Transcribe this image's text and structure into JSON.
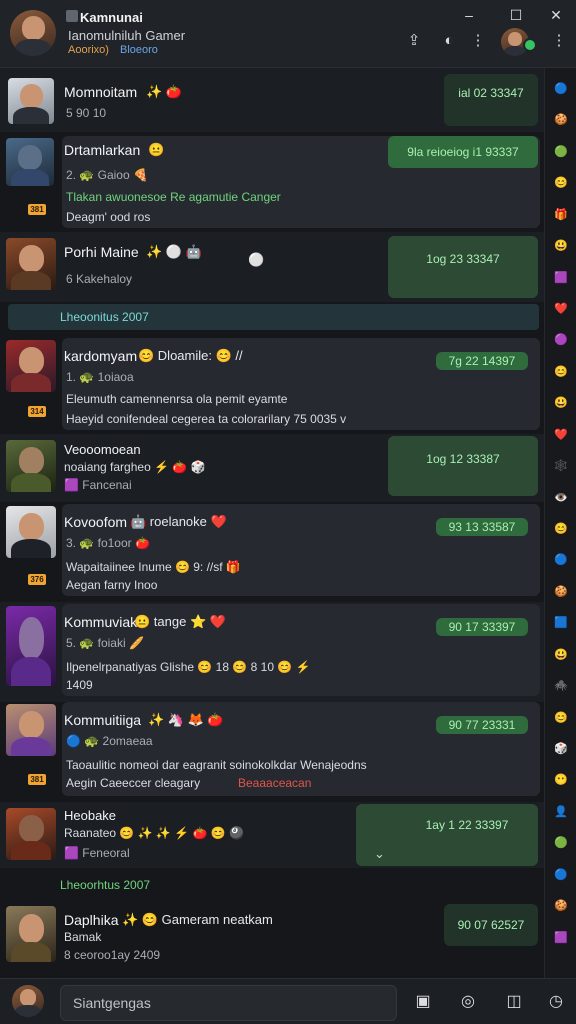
{
  "header": {
    "title": "Kamnunai",
    "subtitle": "Ianomulniluh Gamer",
    "tag1": "Aoorixo)",
    "tag2": "Bloeoro",
    "window": {
      "minimize": "–",
      "maximize": "☐",
      "close": "✕"
    },
    "icons": {
      "share": "⇪",
      "flag": "◐",
      "more": "⋮",
      "menu": "⋮"
    }
  },
  "chats": [
    {
      "name": "Momnoitam",
      "emoji": "✨ 🍅",
      "meta": "5  90 10",
      "time": "ial 02 33347"
    },
    {
      "name": "Drtamlarkan",
      "emoji": "😐",
      "meta": "2.  🐢 Gaioo  🍕",
      "msg1": "Tlakan awuonesoe Re agamutie Canger",
      "msg2": "Deagm' ood ros",
      "time": "9la reioeiog i1 93337",
      "badge": "381"
    },
    {
      "name": "Porhi Maine",
      "emoji": "✨ ⚪ 🤖",
      "meta": "6  Kakehaloy",
      "time": "1og 23 33347"
    },
    {
      "name": "kardomyam",
      "emoji": "😊 Dloamile: 😊 //",
      "meta": "1.  🐢 1oiaoa",
      "msg1": "Eleumuth camennenrsa ola pemit eyamte",
      "msg2": "Haeyid conifendeal cegerea  ta colorarilary 75 0035 v",
      "time": "7g 22 14397",
      "badge": "314"
    },
    {
      "name": "Veooomoean",
      "emoji": "",
      "meta2": "noaiang fargheo  ⚡ 🍅 🎲",
      "meta": "🟪 Fancenai",
      "time": "1og 12 33387"
    },
    {
      "name": "Kovoofom",
      "emoji": "🤖 roelanoke  ❤️",
      "meta": "3.  🐢 fo1oor  🍅",
      "msg1": "Wapaitaiinee Inume  😊 9:  //sf 🎁",
      "msg2": "Aegan farny Inoo",
      "time": "93 13 33587",
      "badge": "376"
    },
    {
      "name": "Kommuviaki",
      "emoji": "😐 tange  ⭐ ❤️",
      "meta": "5.  🐢 foiaki  🥖",
      "msg1": "Ilpenelrpanatiyas Glishe  😊 18   😊 8 10  😊 ⚡",
      "msg2": "1409",
      "time": "90 17 33397"
    },
    {
      "name": "Kommuitiiga",
      "emoji": "✨ 🦄 🦊 🍅",
      "meta": "🔵 🐢 2omaeaa",
      "msg1": "Taoaulitic nomeoi dar eagranit soinokolkdar Wenajeodns",
      "msg2": "Aegin Caeeccer cleagary",
      "msg3": "Beaaaceacan",
      "time": "90 77 23331",
      "badge": "381"
    },
    {
      "name": "Heobake",
      "emoji": "",
      "meta2": "Raanateo  😊 ✨ ✨ ⚡ 🍅 😊 🎱",
      "meta": "🟪 Feneoral",
      "time": "1ay 1 22 33397"
    },
    {
      "name": "Daplhika",
      "emoji": "✨ 😊 Gameram neatkam",
      "meta2": "Bamak",
      "meta": "8  ceoroo1ay 2409",
      "time": "90 07 62527"
    }
  ],
  "dividers": {
    "first": "Lheoonitus 2007",
    "second": "Lheoorhtus 2007"
  },
  "rail": [
    "🔵",
    "🍪",
    "🟢",
    "😊",
    "🎁",
    "😃",
    "🟪",
    "❤️",
    "🟣",
    "😊",
    "😃",
    "❤️",
    "🕸️",
    "👁️",
    "😊",
    "🔵",
    "🍪",
    "🟦",
    "😃",
    "🕷️",
    "😊",
    "🎲",
    "😶",
    "👤",
    "🟢",
    "🔵",
    "🍪",
    "🟪"
  ],
  "footer": {
    "placeholder": "Siantgengas",
    "icons": {
      "attach": "▣",
      "camera": "◎",
      "image": "◫",
      "clock": "◷"
    }
  }
}
